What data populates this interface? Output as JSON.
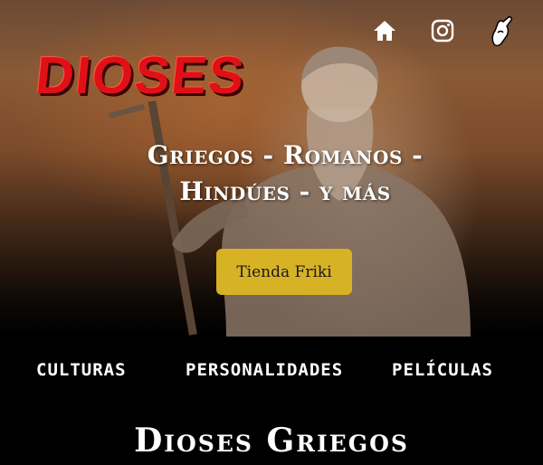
{
  "header": {
    "logo_text": "DIOSES",
    "icons": [
      "home-icon",
      "instagram-icon",
      "sign-language-icon"
    ]
  },
  "hero": {
    "headline_line1": "Griegos - Romanos -",
    "headline_line2": "Hindúes - y más",
    "button_label": "Tienda Friki"
  },
  "menu": {
    "items": [
      {
        "label": "CULTURAS"
      },
      {
        "label": "PERSONALIDADES"
      },
      {
        "label": "PELÍCULAS"
      }
    ]
  },
  "section": {
    "title": "Dioses Griegos"
  },
  "colors": {
    "logo": "#e01017",
    "button": "#d8b225",
    "background": "#000000"
  }
}
